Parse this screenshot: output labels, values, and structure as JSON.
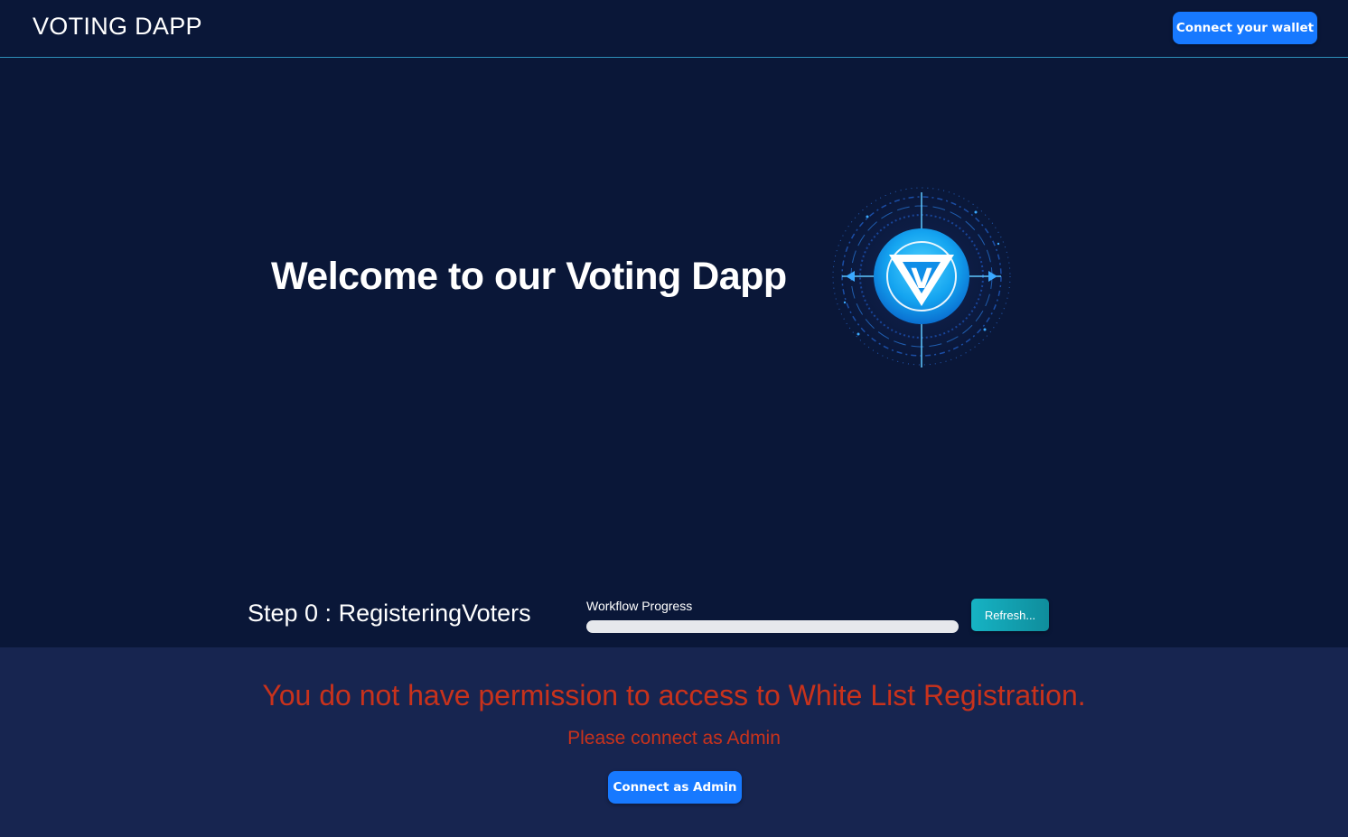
{
  "navbar": {
    "brand": "VOTING DAPP",
    "connect_wallet_label": "Connect your wallet"
  },
  "hero": {
    "title": "Welcome to our Voting Dapp",
    "logo_letter": "V"
  },
  "workflow": {
    "step_text": "Step 0 : RegisteringVoters",
    "progress_label": "Workflow Progress",
    "progress_fraction": 0,
    "refresh_label": "Refresh..."
  },
  "access": {
    "message": "You do not have permission to access to White List Registration.",
    "sub_message": "Please connect as Admin",
    "connect_admin_label": "Connect as Admin"
  },
  "colors": {
    "background": "#0a1738",
    "panel": "#172550",
    "accent_blue": "#1779ff",
    "teal": "#16b3c4",
    "error_red": "#c8321c"
  }
}
